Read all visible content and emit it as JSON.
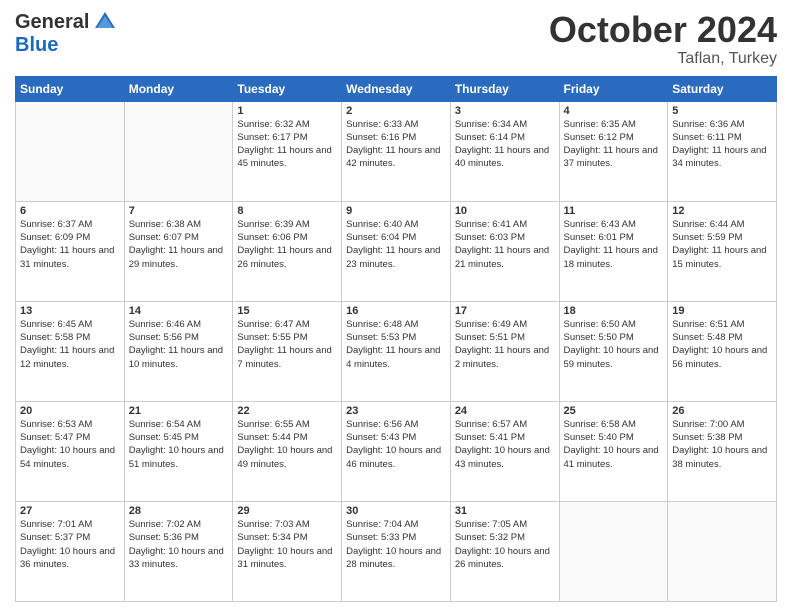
{
  "header": {
    "logo_general": "General",
    "logo_blue": "Blue",
    "month_title": "October 2024",
    "subtitle": "Taflan, Turkey"
  },
  "days_of_week": [
    "Sunday",
    "Monday",
    "Tuesday",
    "Wednesday",
    "Thursday",
    "Friday",
    "Saturday"
  ],
  "weeks": [
    [
      {
        "day": "",
        "info": ""
      },
      {
        "day": "",
        "info": ""
      },
      {
        "day": "1",
        "sunrise": "6:32 AM",
        "sunset": "6:17 PM",
        "daylight": "11 hours and 45 minutes."
      },
      {
        "day": "2",
        "sunrise": "6:33 AM",
        "sunset": "6:16 PM",
        "daylight": "11 hours and 42 minutes."
      },
      {
        "day": "3",
        "sunrise": "6:34 AM",
        "sunset": "6:14 PM",
        "daylight": "11 hours and 40 minutes."
      },
      {
        "day": "4",
        "sunrise": "6:35 AM",
        "sunset": "6:12 PM",
        "daylight": "11 hours and 37 minutes."
      },
      {
        "day": "5",
        "sunrise": "6:36 AM",
        "sunset": "6:11 PM",
        "daylight": "11 hours and 34 minutes."
      }
    ],
    [
      {
        "day": "6",
        "sunrise": "6:37 AM",
        "sunset": "6:09 PM",
        "daylight": "11 hours and 31 minutes."
      },
      {
        "day": "7",
        "sunrise": "6:38 AM",
        "sunset": "6:07 PM",
        "daylight": "11 hours and 29 minutes."
      },
      {
        "day": "8",
        "sunrise": "6:39 AM",
        "sunset": "6:06 PM",
        "daylight": "11 hours and 26 minutes."
      },
      {
        "day": "9",
        "sunrise": "6:40 AM",
        "sunset": "6:04 PM",
        "daylight": "11 hours and 23 minutes."
      },
      {
        "day": "10",
        "sunrise": "6:41 AM",
        "sunset": "6:03 PM",
        "daylight": "11 hours and 21 minutes."
      },
      {
        "day": "11",
        "sunrise": "6:43 AM",
        "sunset": "6:01 PM",
        "daylight": "11 hours and 18 minutes."
      },
      {
        "day": "12",
        "sunrise": "6:44 AM",
        "sunset": "5:59 PM",
        "daylight": "11 hours and 15 minutes."
      }
    ],
    [
      {
        "day": "13",
        "sunrise": "6:45 AM",
        "sunset": "5:58 PM",
        "daylight": "11 hours and 12 minutes."
      },
      {
        "day": "14",
        "sunrise": "6:46 AM",
        "sunset": "5:56 PM",
        "daylight": "11 hours and 10 minutes."
      },
      {
        "day": "15",
        "sunrise": "6:47 AM",
        "sunset": "5:55 PM",
        "daylight": "11 hours and 7 minutes."
      },
      {
        "day": "16",
        "sunrise": "6:48 AM",
        "sunset": "5:53 PM",
        "daylight": "11 hours and 4 minutes."
      },
      {
        "day": "17",
        "sunrise": "6:49 AM",
        "sunset": "5:51 PM",
        "daylight": "11 hours and 2 minutes."
      },
      {
        "day": "18",
        "sunrise": "6:50 AM",
        "sunset": "5:50 PM",
        "daylight": "10 hours and 59 minutes."
      },
      {
        "day": "19",
        "sunrise": "6:51 AM",
        "sunset": "5:48 PM",
        "daylight": "10 hours and 56 minutes."
      }
    ],
    [
      {
        "day": "20",
        "sunrise": "6:53 AM",
        "sunset": "5:47 PM",
        "daylight": "10 hours and 54 minutes."
      },
      {
        "day": "21",
        "sunrise": "6:54 AM",
        "sunset": "5:45 PM",
        "daylight": "10 hours and 51 minutes."
      },
      {
        "day": "22",
        "sunrise": "6:55 AM",
        "sunset": "5:44 PM",
        "daylight": "10 hours and 49 minutes."
      },
      {
        "day": "23",
        "sunrise": "6:56 AM",
        "sunset": "5:43 PM",
        "daylight": "10 hours and 46 minutes."
      },
      {
        "day": "24",
        "sunrise": "6:57 AM",
        "sunset": "5:41 PM",
        "daylight": "10 hours and 43 minutes."
      },
      {
        "day": "25",
        "sunrise": "6:58 AM",
        "sunset": "5:40 PM",
        "daylight": "10 hours and 41 minutes."
      },
      {
        "day": "26",
        "sunrise": "7:00 AM",
        "sunset": "5:38 PM",
        "daylight": "10 hours and 38 minutes."
      }
    ],
    [
      {
        "day": "27",
        "sunrise": "7:01 AM",
        "sunset": "5:37 PM",
        "daylight": "10 hours and 36 minutes."
      },
      {
        "day": "28",
        "sunrise": "7:02 AM",
        "sunset": "5:36 PM",
        "daylight": "10 hours and 33 minutes."
      },
      {
        "day": "29",
        "sunrise": "7:03 AM",
        "sunset": "5:34 PM",
        "daylight": "10 hours and 31 minutes."
      },
      {
        "day": "30",
        "sunrise": "7:04 AM",
        "sunset": "5:33 PM",
        "daylight": "10 hours and 28 minutes."
      },
      {
        "day": "31",
        "sunrise": "7:05 AM",
        "sunset": "5:32 PM",
        "daylight": "10 hours and 26 minutes."
      },
      {
        "day": "",
        "info": ""
      },
      {
        "day": "",
        "info": ""
      }
    ]
  ]
}
